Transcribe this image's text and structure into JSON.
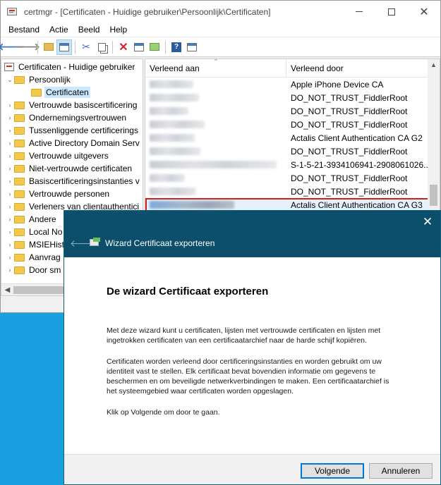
{
  "window": {
    "title": "certmgr - [Certificaten - Huidige gebruiker\\Persoonlijk\\Certificaten]",
    "minimize": "—",
    "maximize": "☐",
    "close": "✕"
  },
  "menu": [
    "Bestand",
    "Actie",
    "Beeld",
    "Help"
  ],
  "toolbar": {
    "icons": [
      "back-arrow-icon",
      "forward-arrow-icon",
      "up-folder-icon",
      "show-hide-tree-icon",
      "cut-icon",
      "copy-icon",
      "delete-icon",
      "properties-icon",
      "export-list-icon",
      "help-icon",
      "console-tree-icon"
    ],
    "back": "🡐",
    "forward": "🡒",
    "delete": "✕",
    "help": "?"
  },
  "tree": {
    "root": "Certificaten - Huidige gebruiker",
    "personal": "Persoonlijk",
    "certificates": "Certificaten",
    "items": [
      "Vertrouwde basiscertificering",
      "Ondernemingsvertrouwen",
      "Tussenliggende certificerings",
      "Active Directory Domain Serv",
      "Vertrouwde uitgevers",
      "Niet-vertrouwde certificaten",
      "Basiscertificeringsinstanties v",
      "Vertrouwde personen",
      "Verleners van clientauthentici",
      "Andere",
      "Local No",
      "MSIEHist",
      "Aanvrag",
      "Door sm"
    ]
  },
  "list": {
    "col_issued_to": "Verleend aan",
    "col_issued_by": "Verleend door",
    "rows": [
      "Apple iPhone Device CA",
      "DO_NOT_TRUST_FiddlerRoot",
      "DO_NOT_TRUST_FiddlerRoot",
      "DO_NOT_TRUST_FiddlerRoot",
      "Actalis Client Authentication CA G2",
      "DO_NOT_TRUST_FiddlerRoot",
      "S-1-5-21-3934106941-2908061026...",
      "DO_NOT_TRUST_FiddlerRoot",
      "DO_NOT_TRUST_FiddlerRoot",
      "Actalis Client Authentication CA G3"
    ],
    "highlighted_row": 9
  },
  "wizard": {
    "caption": "Wizard Certificaat exporteren",
    "close": "✕",
    "back": "🡐",
    "heading": "De wizard Certificaat exporteren",
    "p1": "Met deze wizard kunt u certificaten, lijsten met vertrouwde certificaten en lijsten met ingetrokken certificaten van een certificaatarchief naar de harde schijf kopiëren.",
    "p2": "Certificaten worden verleend door certificeringsinstanties en worden gebruikt om uw identiteit vast te stellen. Elk certificaat bevat bovendien informatie om gegevens te beschermen en om beveiligde netwerkverbindingen te maken. Een certificaatarchief is het systeemgebied waar certificaten worden opgeslagen.",
    "p3": "Klik op Volgende om door te gaan.",
    "next_label": "Volgende",
    "cancel_label": "Annuleren"
  },
  "colors": {
    "desktop": "#1aa0e0",
    "wizard_header": "#0d4e6a",
    "highlight_outline": "#d01e1e",
    "selection": "#cce8ff"
  }
}
